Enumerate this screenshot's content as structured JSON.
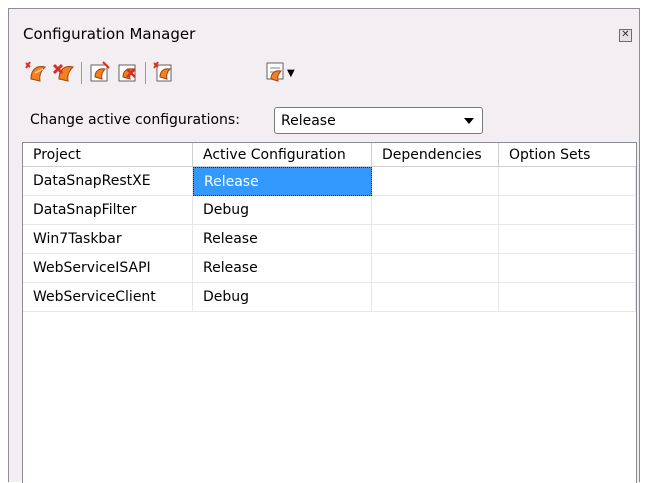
{
  "window": {
    "title": "Configuration Manager",
    "close_glyph": "✕"
  },
  "toolbar": {
    "buttons": [
      {
        "icon": "add-configuration-icon"
      },
      {
        "icon": "delete-configuration-icon"
      },
      {
        "icon": "rename-configuration-icon"
      },
      {
        "icon": "copy-configuration-icon"
      },
      {
        "icon": "option-set-icon"
      },
      {
        "icon": "apply-option-set-icon"
      }
    ],
    "dropdown_arrow": "▼"
  },
  "active_config": {
    "label": "Change active configurations:",
    "value": "Release"
  },
  "colors": {
    "panel_bg": "#f2eef2",
    "selection": "#3399ff",
    "icon_red": "#d83020",
    "icon_orange": "#f08020"
  },
  "grid": {
    "columns": [
      "Project",
      "Active Configuration",
      "Dependencies",
      "Option Sets"
    ],
    "rows": [
      {
        "project": "DataSnapRestXE",
        "config": "Release",
        "dependencies": "",
        "option_sets": "",
        "selected": true
      },
      {
        "project": "DataSnapFilter",
        "config": "Debug",
        "dependencies": "",
        "option_sets": ""
      },
      {
        "project": "Win7Taskbar",
        "config": "Release",
        "dependencies": "",
        "option_sets": ""
      },
      {
        "project": "WebServiceISAPI",
        "config": "Release",
        "dependencies": "",
        "option_sets": ""
      },
      {
        "project": "WebServiceClient",
        "config": "Debug",
        "dependencies": "",
        "option_sets": ""
      }
    ]
  }
}
